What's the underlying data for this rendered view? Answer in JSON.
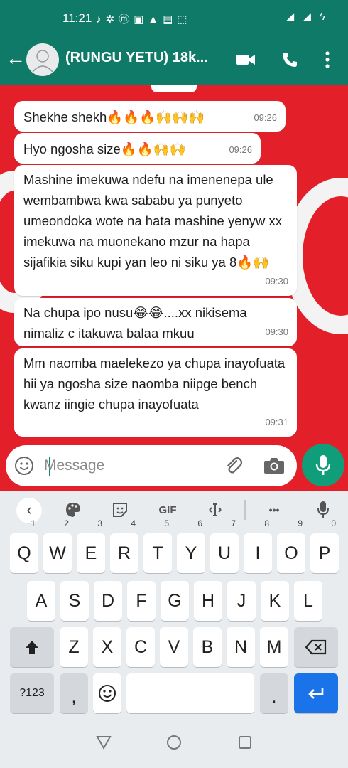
{
  "status_bar": {
    "time": "11:21"
  },
  "chat_header": {
    "title": "(RUNGU YETU) 18k..."
  },
  "messages": [
    {
      "text": "Shekhe shekh🔥🔥🔥🙌🙌🙌",
      "time": "09:26"
    },
    {
      "text": "Hyo ngosha size🔥🔥🙌🙌",
      "time": "09:26"
    },
    {
      "text": "Mashine imekuwa ndefu na imenenepa ule wembambwa kwa sababu ya punyeto umeondoka wote na hata mashine yenyw xx imekuwa na muonekano mzur na hapa sijafikia siku kupi yan leo ni siku ya 8🔥🙌",
      "time": "09:30"
    },
    {
      "text": "Na chupa ipo nusu😂😂....xx nikisema nimaliz c itakuwa balaa mkuu",
      "time": "09:30"
    },
    {
      "text": "Mm naomba maelekezo ya chupa inayofuata hii ya ngosha size naomba niipge bench kwanz iingie chupa inayofuata",
      "time": "09:31"
    }
  ],
  "composer": {
    "placeholder": "Message"
  },
  "keyboard": {
    "toolbar": {
      "gif_label": "GIF",
      "more_label": "•••"
    },
    "row1": [
      {
        "k": "Q",
        "h": "1"
      },
      {
        "k": "W",
        "h": "2"
      },
      {
        "k": "E",
        "h": "3"
      },
      {
        "k": "R",
        "h": "4"
      },
      {
        "k": "T",
        "h": "5"
      },
      {
        "k": "Y",
        "h": "6"
      },
      {
        "k": "U",
        "h": "7"
      },
      {
        "k": "I",
        "h": "8"
      },
      {
        "k": "O",
        "h": "9"
      },
      {
        "k": "P",
        "h": "0"
      }
    ],
    "row2": [
      "A",
      "S",
      "D",
      "F",
      "G",
      "H",
      "J",
      "K",
      "L"
    ],
    "row3": [
      "Z",
      "X",
      "C",
      "V",
      "B",
      "N",
      "M"
    ],
    "symbols_label": "?123",
    "comma_label": ",",
    "period_label": "."
  },
  "colors": {
    "header": "#0f7a68",
    "chat_bg": "#e3202a",
    "accent": "#0f9d7a",
    "enter": "#1a73e8"
  }
}
